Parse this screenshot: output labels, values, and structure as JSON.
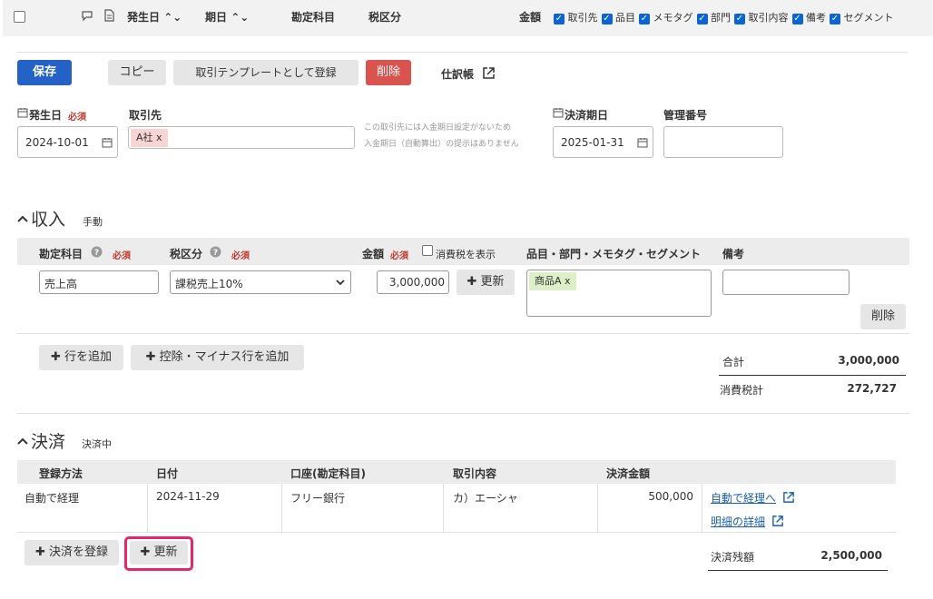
{
  "header": {
    "col_issue_date": "発生日",
    "col_due_date": "期日",
    "col_account": "勘定科目",
    "col_tax": "税区分",
    "col_amount": "金額",
    "filters": [
      "取引先",
      "品目",
      "メモタグ",
      "部門",
      "取引内容",
      "備考",
      "セグメント"
    ]
  },
  "toolbar": {
    "save": "保存",
    "copy": "コピー",
    "register_template": "取引テンプレートとして登録",
    "delete": "削除",
    "journal": "仕訳帳"
  },
  "form": {
    "issue_date_label": "発生日",
    "required": "必須",
    "issue_date_value": "2024-10-01",
    "partner_label": "取引先",
    "partner_tag": "A社 x",
    "partner_note_1": "この取引先には入金期日設定がないため",
    "partner_note_2": "入金期日（自動算出）の提示はありません",
    "due_date_label": "決済期日",
    "due_date_value": "2025-01-31",
    "mgmt_no_label": "管理番号",
    "mgmt_no_value": ""
  },
  "income": {
    "title": "収入",
    "mode": "手動",
    "col_account": "勘定科目",
    "col_tax": "税区分",
    "col_amount": "金額",
    "show_tax_label": "消費税を表示",
    "col_items": "品目・部門・メモタグ・セグメント",
    "col_note": "備考",
    "account_value": "売上高",
    "tax_value": "課税売上10%",
    "amount_value": "3,000,000",
    "update_btn": "更新",
    "item_tag": "商品A x",
    "note_value": "",
    "row_delete": "削除",
    "add_row": "行を追加",
    "add_minus_row": "控除・マイナス行を追加",
    "total_label": "合計",
    "total_value": "3,000,000",
    "tax_label": "消費税計",
    "tax_total": "272,727"
  },
  "settlement": {
    "title": "決済",
    "status": "決済中",
    "columns": [
      "登録方法",
      "日付",
      "口座(勘定科目)",
      "取引内容",
      "決済金額"
    ],
    "row": {
      "method": "自動で経理",
      "date": "2024-11-29",
      "account": "フリー銀行",
      "content": "カ）エーシャ",
      "amount": "500,000",
      "link1": "自動で経理へ",
      "link2": "明細の詳細"
    },
    "add_btn": "決済を登録",
    "update_btn": "更新",
    "balance_label": "決済残額",
    "balance_value": "2,500,000"
  },
  "colors": {
    "primary": "#2462c8",
    "danger": "#d9534f",
    "highlight": "#e8246b",
    "partner_tag_bg": "#f8d4d4",
    "item_tag_bg": "#dcefc8"
  }
}
